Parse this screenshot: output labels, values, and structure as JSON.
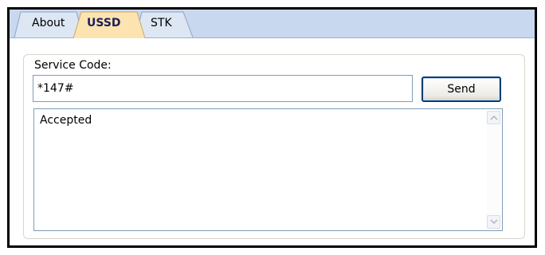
{
  "tabs": [
    {
      "label": "About",
      "active": false
    },
    {
      "label": "USSD",
      "active": true
    },
    {
      "label": "STK",
      "active": false
    }
  ],
  "ussd": {
    "service_code_label": "Service Code:",
    "service_code_value": "*147#",
    "send_label": "Send",
    "response_text": "Accepted"
  },
  "colors": {
    "tabbar_bg": "#c8d8ee",
    "active_tab_bg": "#fce3b0",
    "active_tab_text": "#1a1f5c",
    "button_border": "#003c74"
  },
  "icons": {
    "scroll_up": "chevron-up-icon",
    "scroll_down": "chevron-down-icon"
  }
}
